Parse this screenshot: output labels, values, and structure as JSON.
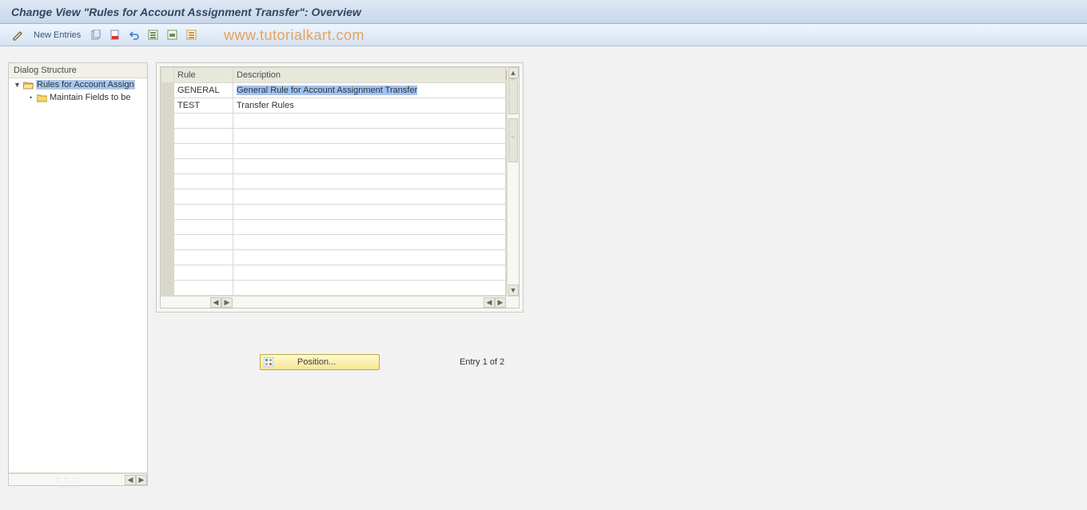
{
  "title": "Change View \"Rules for Account Assignment Transfer\": Overview",
  "toolbar": {
    "new_entries_label": "New Entries"
  },
  "watermark": "www.tutorialkart.com",
  "tree": {
    "header": "Dialog Structure",
    "node1": "Rules for Account Assign",
    "node2": "Maintain Fields to be"
  },
  "table": {
    "cols": {
      "rule": "Rule",
      "description": "Description"
    },
    "rows": [
      {
        "rule": "GENERAL",
        "description": "General Rule for Account Assignment Transfer"
      },
      {
        "rule": "TEST",
        "description": "Transfer Rules"
      }
    ]
  },
  "position": {
    "label": "Position...",
    "entry_text": "Entry 1 of 2"
  }
}
